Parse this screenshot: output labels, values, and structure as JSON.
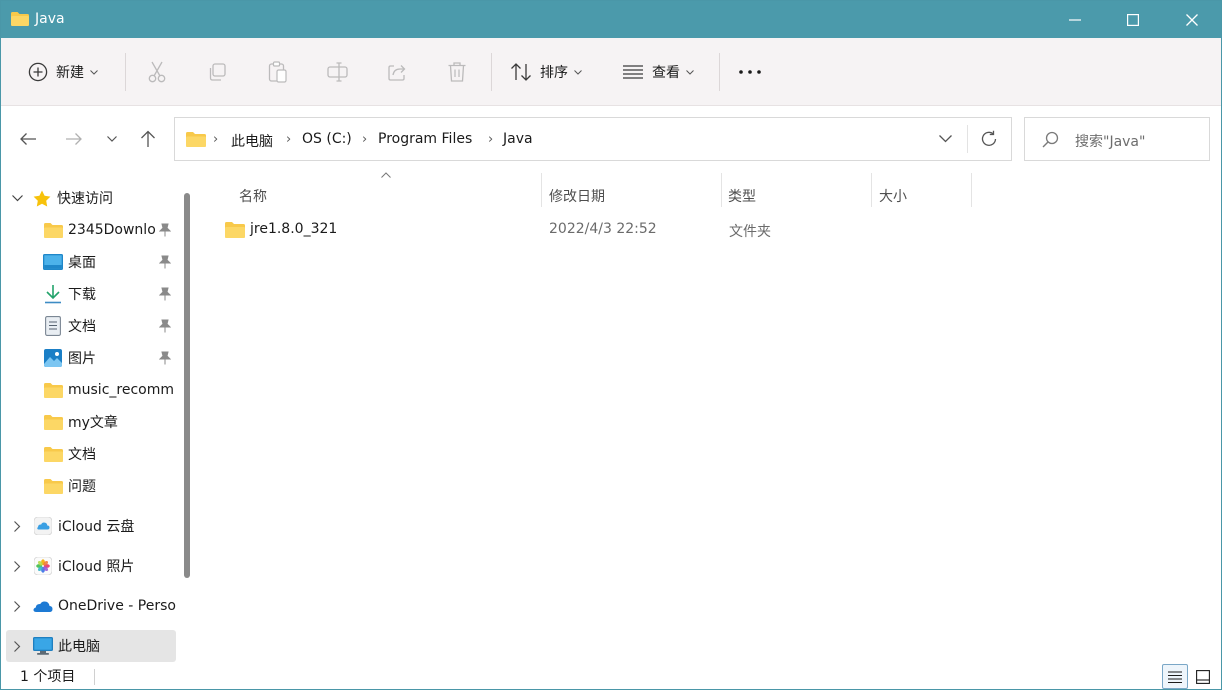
{
  "window": {
    "title": "Java",
    "minimize_icon": "minimize-icon",
    "maximize_icon": "maximize-icon",
    "close_icon": "close-icon"
  },
  "toolbar": {
    "new_label": "新建",
    "sort_label": "排序",
    "view_label": "查看",
    "icons": [
      "plus-circle-icon",
      "cut-icon",
      "copy-icon",
      "paste-icon",
      "rename-icon",
      "share-icon",
      "delete-icon",
      "sort-icon",
      "view-icon",
      "more-icon"
    ]
  },
  "address": {
    "breadcrumbs": [
      "此电脑",
      "OS (C:)",
      "Program Files",
      "Java"
    ],
    "search_placeholder": "搜索\"Java\""
  },
  "sidebar": {
    "quick_access_label": "快速访问",
    "quick_items": [
      {
        "label": "2345Downlo",
        "icon": "folder-icon",
        "pinned": true
      },
      {
        "label": "桌面",
        "icon": "desktop-icon",
        "pinned": true
      },
      {
        "label": "下载",
        "icon": "download-icon",
        "pinned": true
      },
      {
        "label": "文档",
        "icon": "document-icon",
        "pinned": true
      },
      {
        "label": "图片",
        "icon": "pictures-icon",
        "pinned": true
      },
      {
        "label": "music_recomm",
        "icon": "folder-icon",
        "pinned": false
      },
      {
        "label": "my文章",
        "icon": "folder-icon",
        "pinned": false
      },
      {
        "label": "文档",
        "icon": "folder-icon",
        "pinned": false
      },
      {
        "label": "问题",
        "icon": "folder-icon",
        "pinned": false
      }
    ],
    "groups": [
      {
        "label": "iCloud 云盘",
        "icon": "icloud-drive-icon"
      },
      {
        "label": "iCloud 照片",
        "icon": "icloud-photos-icon"
      },
      {
        "label": "OneDrive - Perso",
        "icon": "onedrive-icon"
      },
      {
        "label": "此电脑",
        "icon": "this-pc-icon"
      }
    ]
  },
  "columns": {
    "name": "名称",
    "modified": "修改日期",
    "type": "类型",
    "size": "大小"
  },
  "files": [
    {
      "name": "jre1.8.0_321",
      "modified": "2022/4/3 22:52",
      "type": "文件夹",
      "size": ""
    }
  ],
  "status": {
    "count": "1 个项目"
  },
  "colors": {
    "titlebar": "#4b9aab",
    "folder": "#f8c94a",
    "selected": "#e5e5e5"
  }
}
